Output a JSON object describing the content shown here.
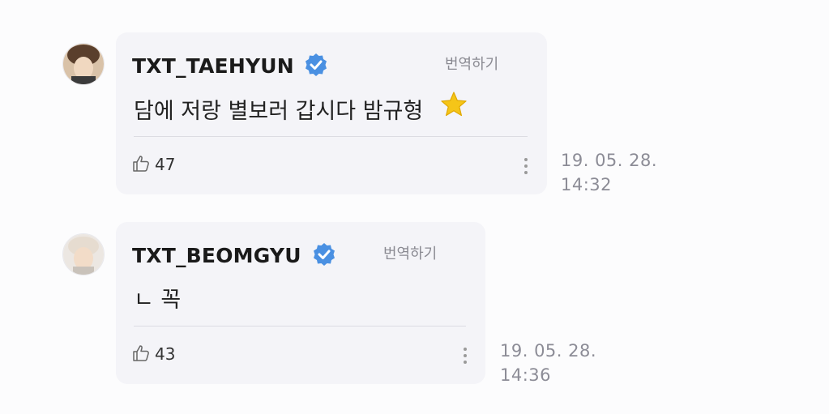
{
  "comments": [
    {
      "username": "TXT_TAEHYUN",
      "verified": true,
      "translate_label": "번역하기",
      "message": "담에 저랑 별보러 갑시다 밤규형",
      "message_emoji": "star-emoji",
      "likes": "47",
      "date": "19. 05. 28.",
      "time": "14:32"
    },
    {
      "username": "TXT_BEOMGYU",
      "verified": true,
      "translate_label": "번역하기",
      "message": "ㄴ 꼭",
      "likes": "43",
      "date": "19. 05. 28.",
      "time": "14:36"
    }
  ],
  "colors": {
    "verified_badge": "#4a90e2",
    "card_background": "#f4f4f8",
    "star": "#f5c518"
  },
  "icons": [
    "verified-icon",
    "thumbs-up-icon",
    "more-vertical-icon",
    "star-emoji"
  ]
}
